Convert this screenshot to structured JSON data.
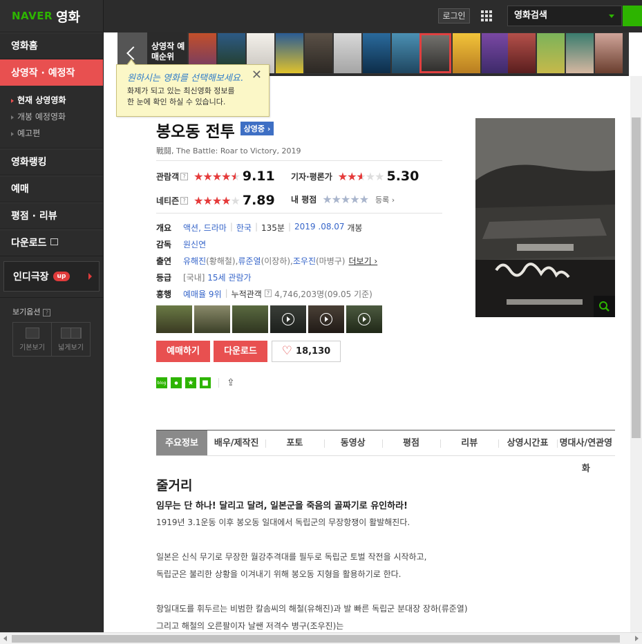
{
  "logo": {
    "brand": "NAVER",
    "service": "영화"
  },
  "sidebar": {
    "items": [
      {
        "label": "영화홈"
      },
      {
        "label": "상영작 · 예정작"
      },
      {
        "label": "영화랭킹"
      },
      {
        "label": "예매"
      },
      {
        "label": "평점 · 리뷰"
      },
      {
        "label": "다운로드"
      }
    ],
    "subitems": [
      {
        "label": "현재 상영영화"
      },
      {
        "label": "개봉 예정영화"
      },
      {
        "label": "예고편"
      }
    ],
    "indie": {
      "label": "인디극장",
      "badge": "up"
    },
    "view_options": {
      "title": "보기옵션",
      "q": "?",
      "basic": "기본보기",
      "wide": "넓게보기"
    }
  },
  "header": {
    "login": "로그인",
    "search_label": "영화검색"
  },
  "strip": {
    "label": "상영작 예매순위"
  },
  "tooltip": {
    "headline": "원하시는 영화를 선택해보세요.",
    "line1": "화제가 되고 있는 최신영화 정보를",
    "line2": "한 눈에 확인 하실 수 있습니다.",
    "close": "✕"
  },
  "movie": {
    "title": "봉오동 전투",
    "status": "상영중 ›",
    "subtitle": "戰鬪, The Battle: Roar to Victory, 2019",
    "scores": {
      "audience": {
        "label": "관람객",
        "value": "9.11",
        "q": "?"
      },
      "critic": {
        "label": "기자·평론가",
        "value": "5.30"
      },
      "netizen": {
        "label": "네티즌",
        "value": "7.89",
        "q": "?"
      },
      "mine": {
        "label": "내 평점",
        "register": "등록 ›"
      }
    },
    "info": {
      "overview_label": "개요",
      "genre": "액션, 드라마",
      "country": "한국",
      "runtime": "135분",
      "release": "2019 .08.07",
      "release_suffix": "개봉",
      "director_label": "감독",
      "director": "원신연",
      "cast_label": "출연",
      "cast": [
        {
          "name": "유해진",
          "role": "(황해철), "
        },
        {
          "name": "류준열",
          "role": "(이장하), "
        },
        {
          "name": "조우진",
          "role": "(마병구)"
        }
      ],
      "more": "더보기 ›",
      "rating_label": "등급",
      "rating_prefix": "[국내]",
      "rating": "15세 관람가",
      "box_label": "흥행",
      "booking_rank": "예매율 9위",
      "cumulative_label": "누적관객",
      "cumulative_q": "?",
      "cumulative": "4,746,203명(09.05 기준)"
    },
    "buttons": {
      "reserve": "예매하기",
      "download": "다운로드",
      "likes": "18,130"
    }
  },
  "tabs": [
    "주요정보",
    "배우/제작진",
    "포토",
    "동영상",
    "평점",
    "리뷰",
    "상영시간표",
    "명대사/연관영화"
  ],
  "story": {
    "heading": "줄거리",
    "lead": "임무는 단 하나! 달리고 달려, 일본군을 죽음의 골짜기로 유인하라!",
    "lines": [
      "1919년 3.1운동 이후 봉오동 일대에서 독립군의 무장항쟁이 활발해진다.",
      " 일본은 신식 무기로 무장한 월강추격대를 필두로 독립군 토벌 작전을 시작하고,",
      "독립군은 불리한 상황을 이겨내기 위해 봉오동 지형을 활용하기로 한다.",
      " 항일대도를 휘두르는 비범한 칼솜씨의 해철(유해진)과 발 빠른 독립군 분대장 장하(류준열)",
      "그리고 해철의 오른팔이자 날쌘 저격수 병구(조우진)는"
    ]
  },
  "colors": {
    "accent_red": "#e85050",
    "naver_green": "#2db400",
    "link_blue": "#3665c9"
  }
}
